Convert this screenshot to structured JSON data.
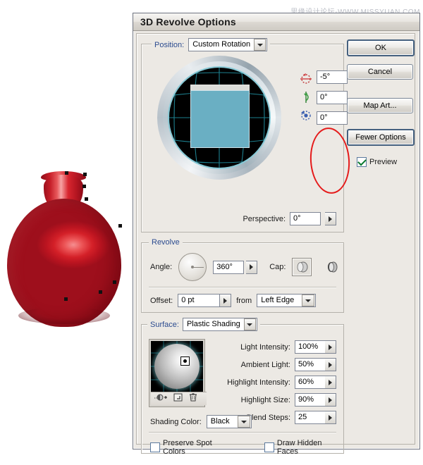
{
  "watermark": "思缘设计论坛-WWW.MISSYUAN.COM",
  "dialog": {
    "title": "3D Revolve Options"
  },
  "position": {
    "label": "Position:",
    "value": "Custom Rotation",
    "rotation_x": "-5°",
    "rotation_y": "0°",
    "rotation_z": "0°",
    "perspective_label": "Perspective:",
    "perspective_value": "0°"
  },
  "revolve": {
    "legend": "Revolve",
    "angle_label": "Angle:",
    "angle_value": "360°",
    "cap_label": "Cap:",
    "offset_label": "Offset:",
    "offset_value": "0 pt",
    "from_label": "from",
    "from_value": "Left Edge"
  },
  "surface": {
    "legend": "Surface:",
    "shading_value": "Plastic Shading",
    "rows": [
      {
        "label": "Light Intensity:",
        "value": "100%"
      },
      {
        "label": "Ambient Light:",
        "value": "50%"
      },
      {
        "label": "Highlight Intensity:",
        "value": "60%"
      },
      {
        "label": "Highlight Size:",
        "value": "90%"
      },
      {
        "label": "Blend Steps:",
        "value": "25"
      }
    ],
    "shading_color_label": "Shading Color:",
    "shading_color_value": "Black",
    "preserve_spot_colors": "Preserve Spot Colors",
    "draw_hidden_faces": "Draw Hidden Faces",
    "light_buttons": {
      "new": "new-light-icon",
      "duplicate": "duplicate-light-icon",
      "delete": "delete-light-icon"
    }
  },
  "buttons": {
    "ok": "OK",
    "cancel": "Cancel",
    "map_art": "Map Art...",
    "fewer_options": "Fewer Options",
    "preview": "Preview"
  },
  "colors": {
    "accent_blue": "#2b4b8f",
    "dialog_bg": "#ece9e4",
    "annotation_red": "#e51b1b",
    "vase_red": "#d42028",
    "cube_cyan": "#6aafc3"
  }
}
